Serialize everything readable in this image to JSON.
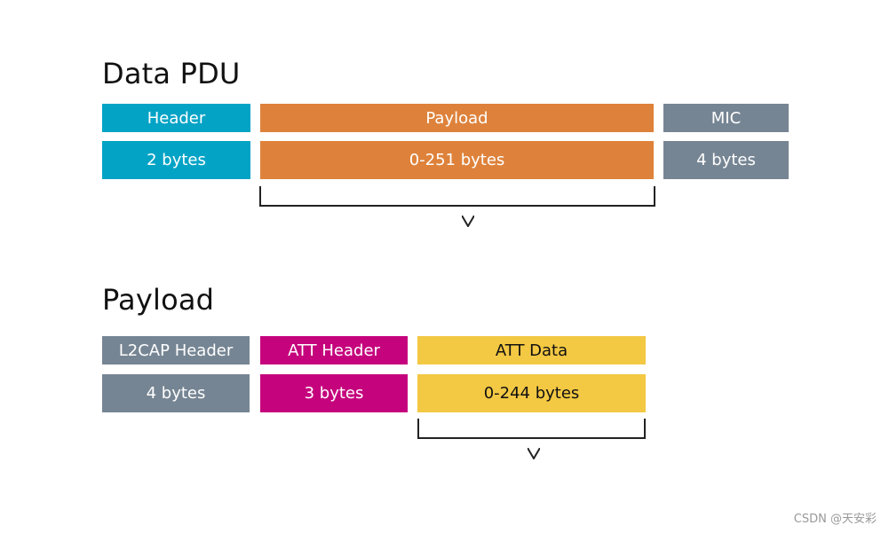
{
  "colors": {
    "header": "#03A3C6",
    "payload": "#DE823B",
    "mic": "#768593",
    "l2cap": "#768593",
    "att_header": "#C5037D",
    "att_data": "#F3C843"
  },
  "data_pdu": {
    "title": "Data PDU",
    "fields": [
      {
        "label": "Header",
        "size": "2 bytes"
      },
      {
        "label": "Payload",
        "size": "0-251 bytes"
      },
      {
        "label": "MIC",
        "size": "4 bytes"
      }
    ]
  },
  "payload": {
    "title": "Payload",
    "fields": [
      {
        "label": "L2CAP Header",
        "size": "4 bytes"
      },
      {
        "label": "ATT Header",
        "size": "3 bytes"
      },
      {
        "label": "ATT Data",
        "size": "0-244 bytes"
      }
    ]
  },
  "watermark": "CSDN @天安彩"
}
